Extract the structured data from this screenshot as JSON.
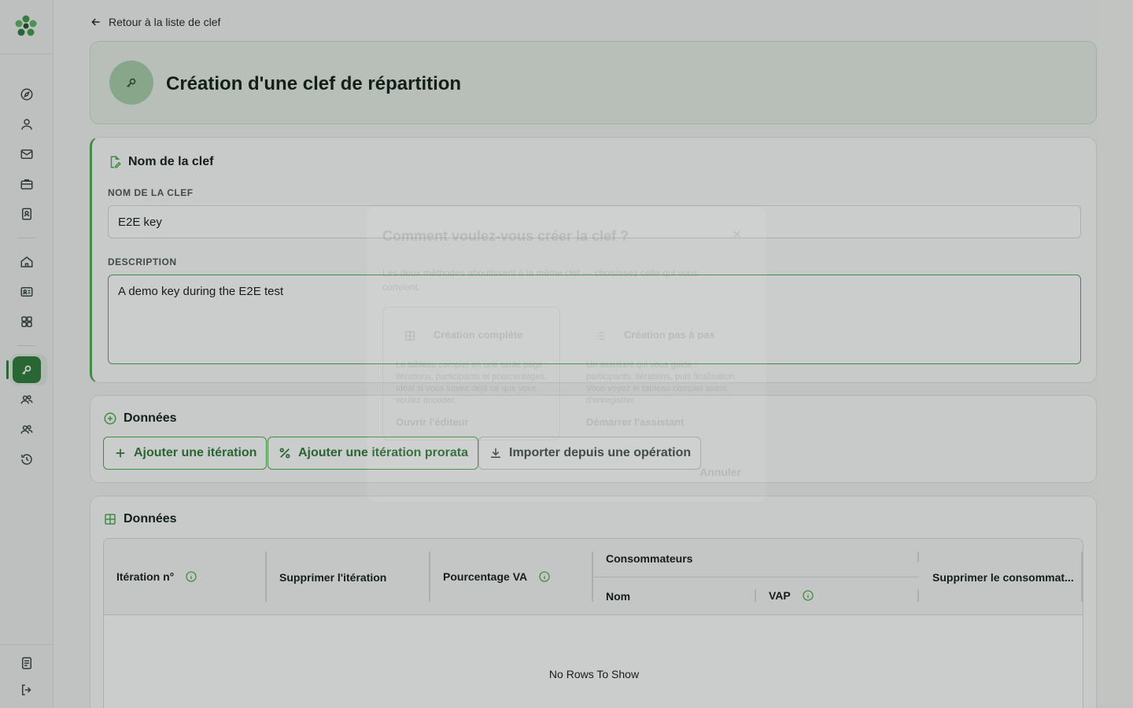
{
  "back_link": {
    "label": "Retour à la liste de clef"
  },
  "header": {
    "title": "Création d'une clef de répartition"
  },
  "name_section": {
    "title": "Nom de la clef",
    "name_label": "NOM DE LA CLEF",
    "name_value": "E2E key",
    "description_label": "DESCRIPTION",
    "description_value": "A demo key during the E2E test"
  },
  "data_section": {
    "title": "Données",
    "buttons": {
      "add_iteration": "Ajouter une itération",
      "add_iteration_prorata": "Ajouter une itération prorata",
      "import_operation": "Importer depuis une opération"
    }
  },
  "grid_section": {
    "title": "Données",
    "columns": {
      "iteration": "Itération n°",
      "delete_iteration": "Supprimer l'itération",
      "percentage_va": "Pourcentage VA",
      "consumers": "Consommateurs",
      "name": "Nom",
      "vap": "VAP",
      "delete_consumer": "Supprimer le consommat..."
    },
    "empty": "No Rows To Show"
  },
  "modal": {
    "title": "Comment voulez-vous créer la clef ?",
    "close": "×",
    "description": "Les deux méthodes aboutissent à la même clef — choisissez celle qui vous convient.",
    "option_full": {
      "title": "Création complète",
      "description": "Le tableau complet en une seule page : itérations, participants et pourcentages. Idéal si vous savez déjà ce que vous voulez encoder.",
      "link": "Ouvrir l'éditeur"
    },
    "option_step": {
      "title": "Création pas à pas",
      "description": "Un assistant qui vous guide : participants, itérations, puis finalisation. Vous voyez le tableau complet avant d'enregistrer.",
      "link": "Démarrer l'assistant"
    },
    "cancel": "Annuler"
  },
  "icons": {
    "accent": "#4caf50",
    "brand": "#2f7d3c"
  }
}
